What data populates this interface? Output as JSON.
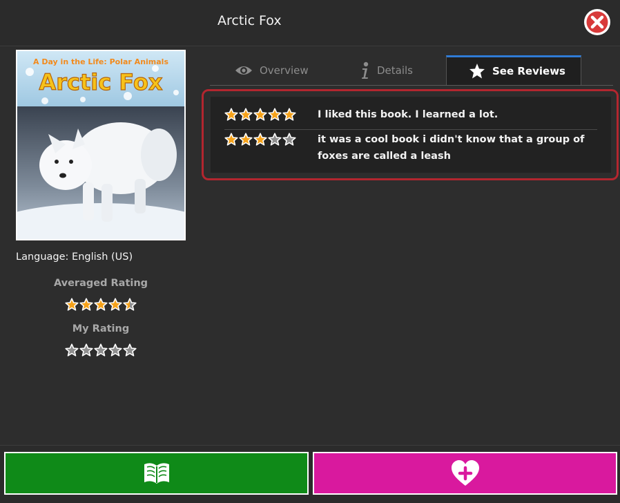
{
  "book": {
    "title": "Arctic Fox",
    "cover_series": "A Day in the Life: Polar Animals",
    "cover_title": "Arctic Fox",
    "language_label": "Language: English (US)"
  },
  "ratings": {
    "averaged_label": "Averaged Rating",
    "averaged_value": 4.5,
    "my_label": "My Rating",
    "my_value": 0
  },
  "tabs": [
    {
      "label": "Overview",
      "icon": "eye-icon",
      "active": false
    },
    {
      "label": "Details",
      "icon": "info-icon",
      "active": false
    },
    {
      "label": "See Reviews",
      "icon": "star-icon",
      "active": true
    }
  ],
  "reviews": [
    {
      "stars": 5,
      "text": "I liked this book. I learned a lot."
    },
    {
      "stars": 3,
      "text": "it was a cool book i didn't know that a group of foxes are called a leash"
    }
  ],
  "colors": {
    "star_filled": "#f5a21b",
    "star_empty": "#8e8e8e",
    "read_button": "#0f8a18",
    "favorite_button": "#d9199e",
    "highlight_border": "#b3262f",
    "active_tab_accent": "#2f7bd6"
  },
  "footer": {
    "read_icon": "open-book-icon",
    "favorite_icon": "heart-plus-icon"
  }
}
